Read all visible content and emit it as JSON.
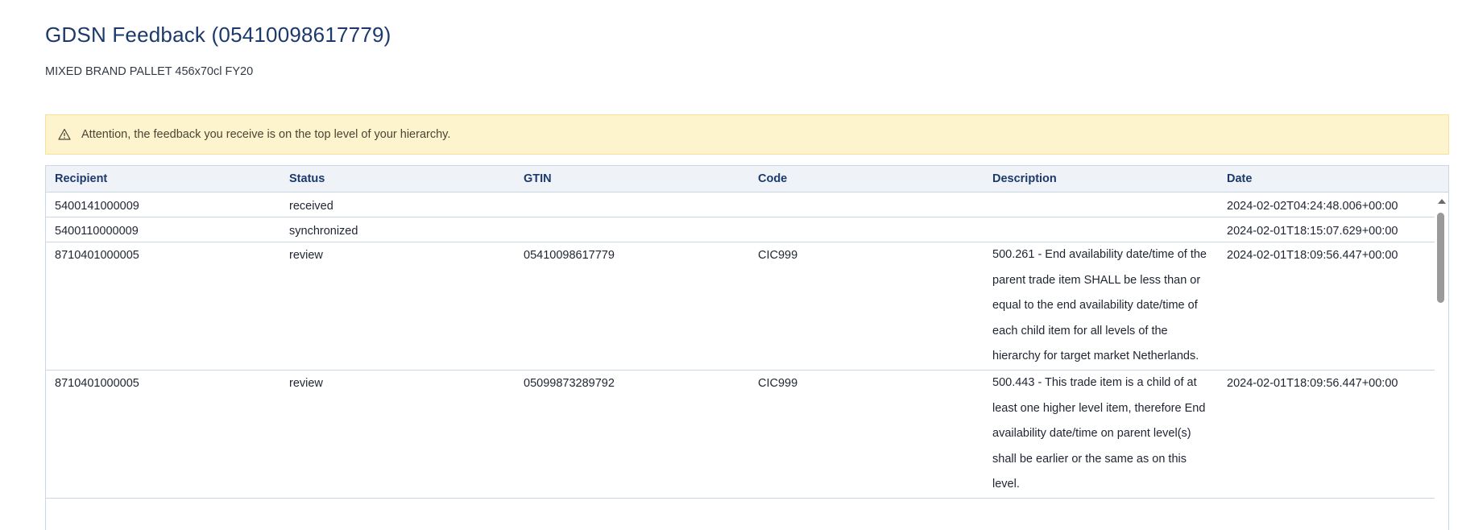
{
  "header": {
    "title": "GDSN Feedback (05410098617779)",
    "subtitle": "MIXED BRAND PALLET 456x70cl FY20"
  },
  "alert": {
    "icon": "warning-icon",
    "text": "Attention, the feedback you receive is on the top level of your hierarchy."
  },
  "table": {
    "columns": [
      "Recipient",
      "Status",
      "GTIN",
      "Code",
      "Description",
      "Date"
    ],
    "rows": [
      {
        "recipient": "5400141000009",
        "status": "received",
        "gtin": "",
        "code": "",
        "description": "",
        "date": "2024-02-02T04:24:48.006+00:00"
      },
      {
        "recipient": "5400110000009",
        "status": "synchronized",
        "gtin": "",
        "code": "",
        "description": "",
        "date": "2024-02-01T18:15:07.629+00:00"
      },
      {
        "recipient": "8710401000005",
        "status": "review",
        "gtin": "05410098617779",
        "code": "CIC999",
        "description": "500.261 - End availability date/time of the parent trade item SHALL be less than or equal to the end availability date/time of each child item for all levels of the hierarchy for target market Netherlands.",
        "date": "2024-02-01T18:09:56.447+00:00"
      },
      {
        "recipient": "8710401000005",
        "status": "review",
        "gtin": "05099873289792",
        "code": "CIC999",
        "description": "500.443 - This trade item is a child of at least one higher level item, therefore End availability date/time on parent level(s) shall be earlier or the same as on this level.",
        "date": "2024-02-01T18:09:56.447+00:00"
      }
    ]
  }
}
